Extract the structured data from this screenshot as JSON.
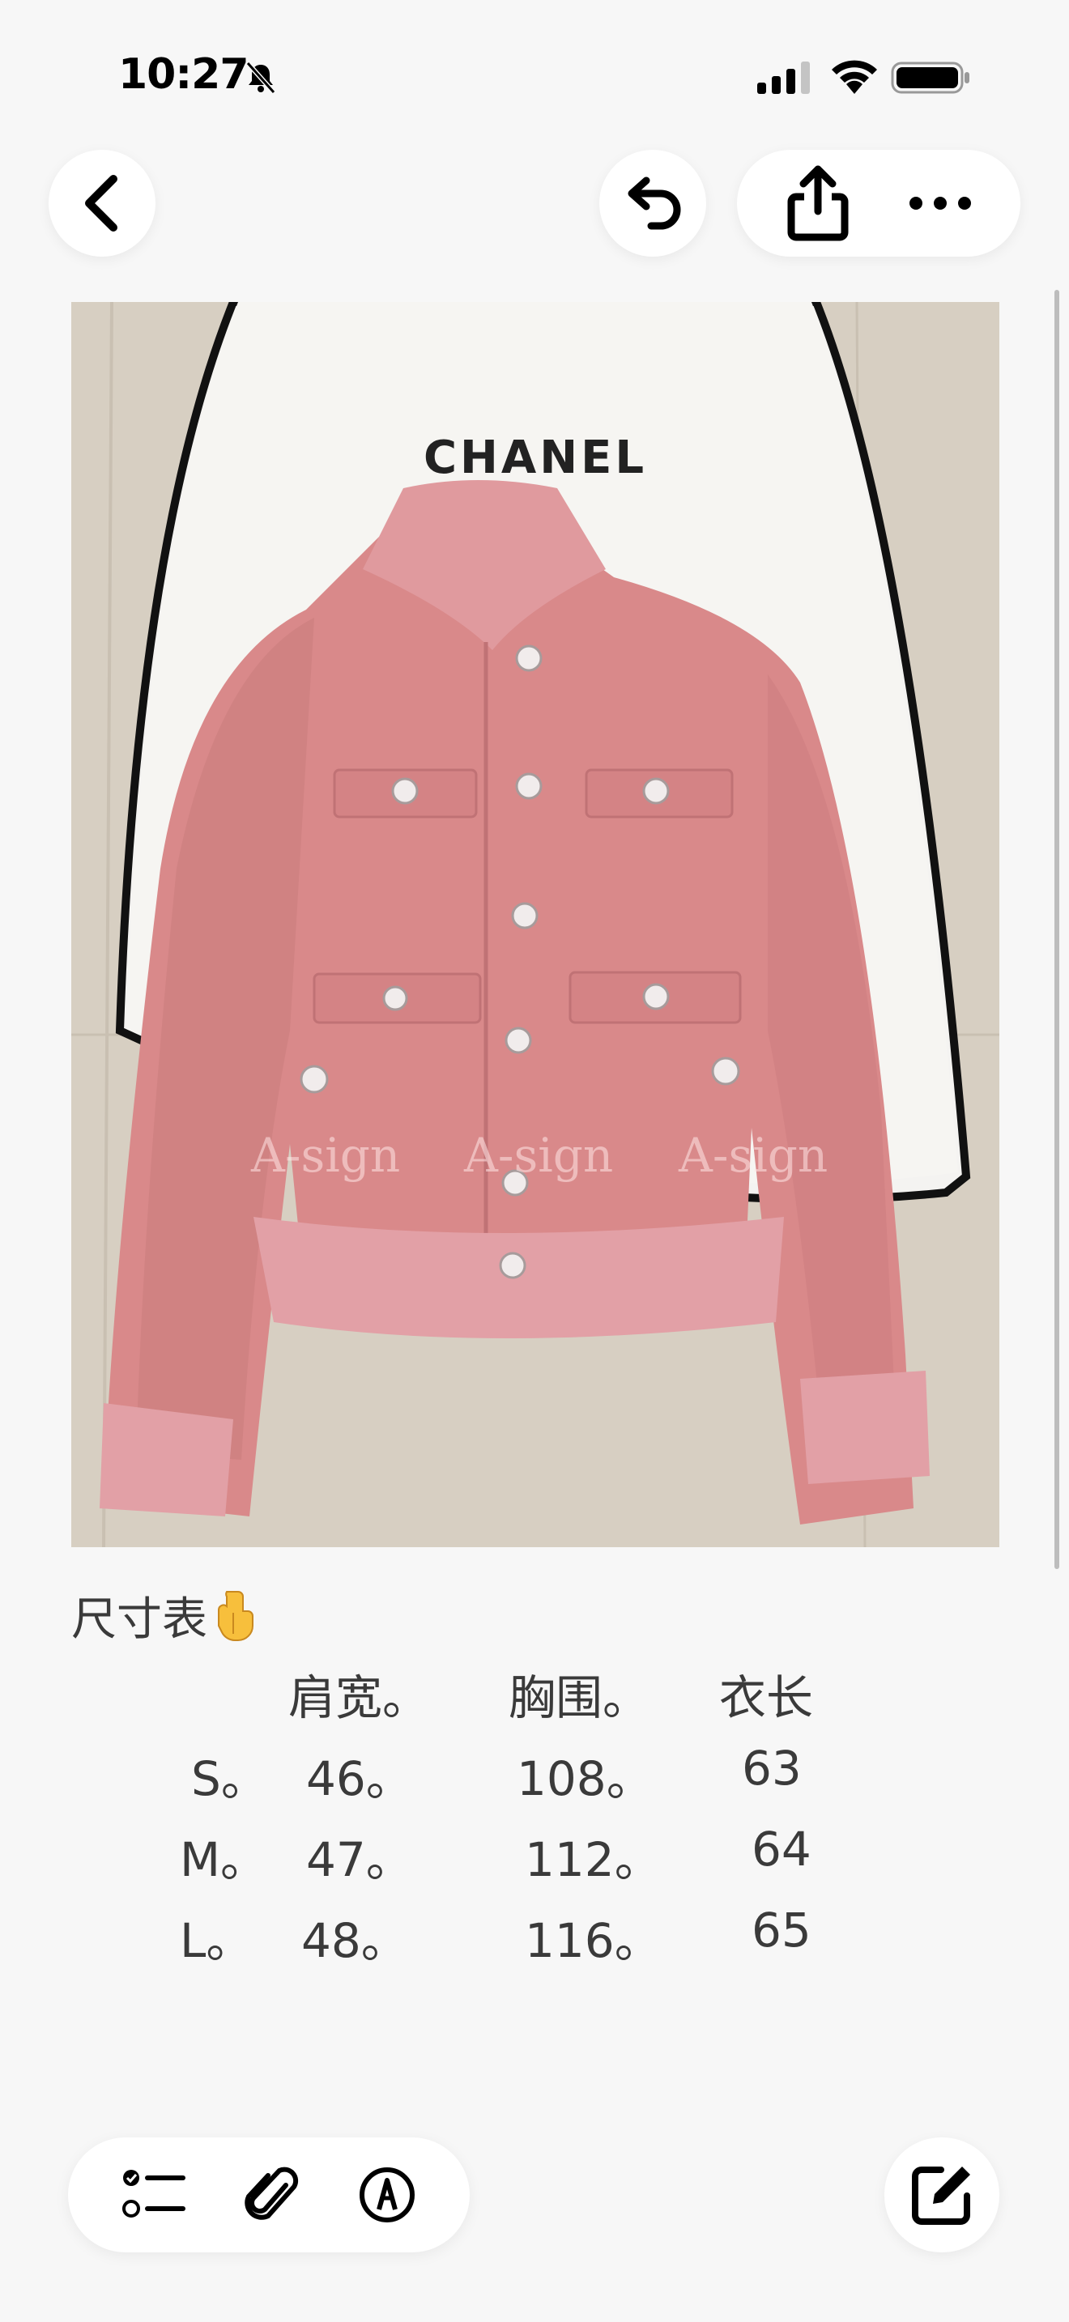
{
  "status_bar": {
    "time": "10:27"
  },
  "photo": {
    "brand_text": "CHANEL",
    "watermarks": [
      "A-sign",
      "A-sign",
      "A-sign"
    ]
  },
  "note": {
    "heading": "尺寸表",
    "table": {
      "headers": [
        "肩宽。",
        "胸围。",
        "衣长"
      ],
      "rows": [
        {
          "size": "S。",
          "values": [
            "46。",
            "108。",
            "63"
          ]
        },
        {
          "size": "M。",
          "values": [
            "47。",
            "112。",
            "64"
          ]
        },
        {
          "size": "L。",
          "values": [
            "48。",
            "116。",
            "65"
          ]
        }
      ]
    }
  },
  "icons": {
    "back": "chevron-left-icon",
    "undo": "undo-icon",
    "share": "share-icon",
    "more": "more-icon",
    "checklist": "checklist-icon",
    "attach": "paperclip-icon",
    "markup": "markup-pen-icon",
    "compose": "compose-icon"
  }
}
